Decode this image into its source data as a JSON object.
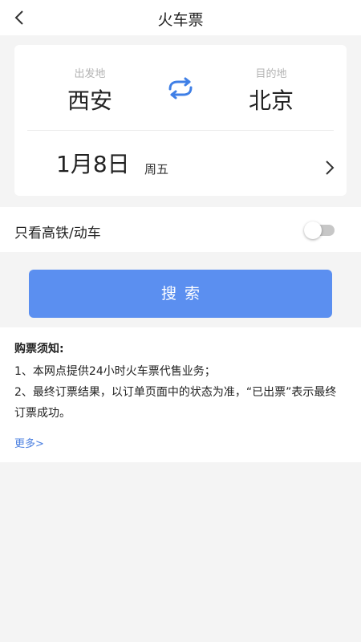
{
  "header": {
    "title": "火车票",
    "back_icon": "chevron-left-icon"
  },
  "route": {
    "from_label": "出发地",
    "from_city": "西安",
    "to_label": "目的地",
    "to_city": "北京",
    "swap_icon": "swap-icon",
    "swap_color": "#3f7fe6"
  },
  "date": {
    "date_text": "1月8日",
    "weekday": "周五",
    "chevron_icon": "chevron-right-icon"
  },
  "filter": {
    "label": "只看高铁/动车",
    "enabled": false
  },
  "search": {
    "label": "搜索",
    "color": "#5b8ff0"
  },
  "notice": {
    "title": "购票须知:",
    "items": [
      "1、本网点提供24小时火车票代售业务；",
      "2、最终订票结果，以订单页面中的状态为准，“已出票”表示最终订票成功。"
    ],
    "more_label": "更多>",
    "link_color": "#4a7fe0"
  }
}
